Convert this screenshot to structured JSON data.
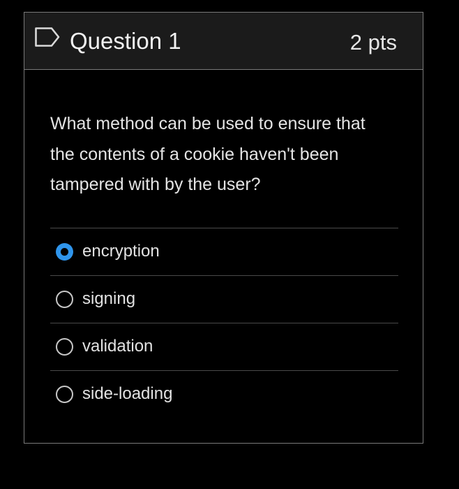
{
  "question": {
    "flag_icon": "flag-outline-icon",
    "title": "Question 1",
    "points": "2 pts",
    "text": "What method can be used to ensure that the contents of a cookie haven't been tampered with by the user?"
  },
  "answers": [
    {
      "label": "encryption",
      "selected": true
    },
    {
      "label": "signing",
      "selected": false
    },
    {
      "label": "validation",
      "selected": false
    },
    {
      "label": "side-loading",
      "selected": false
    }
  ],
  "colors": {
    "background": "#000000",
    "header": "#1b1b1b",
    "border": "#7a7a7a",
    "radio_selected": "#2f95ec",
    "text": "#e4e4e4"
  }
}
